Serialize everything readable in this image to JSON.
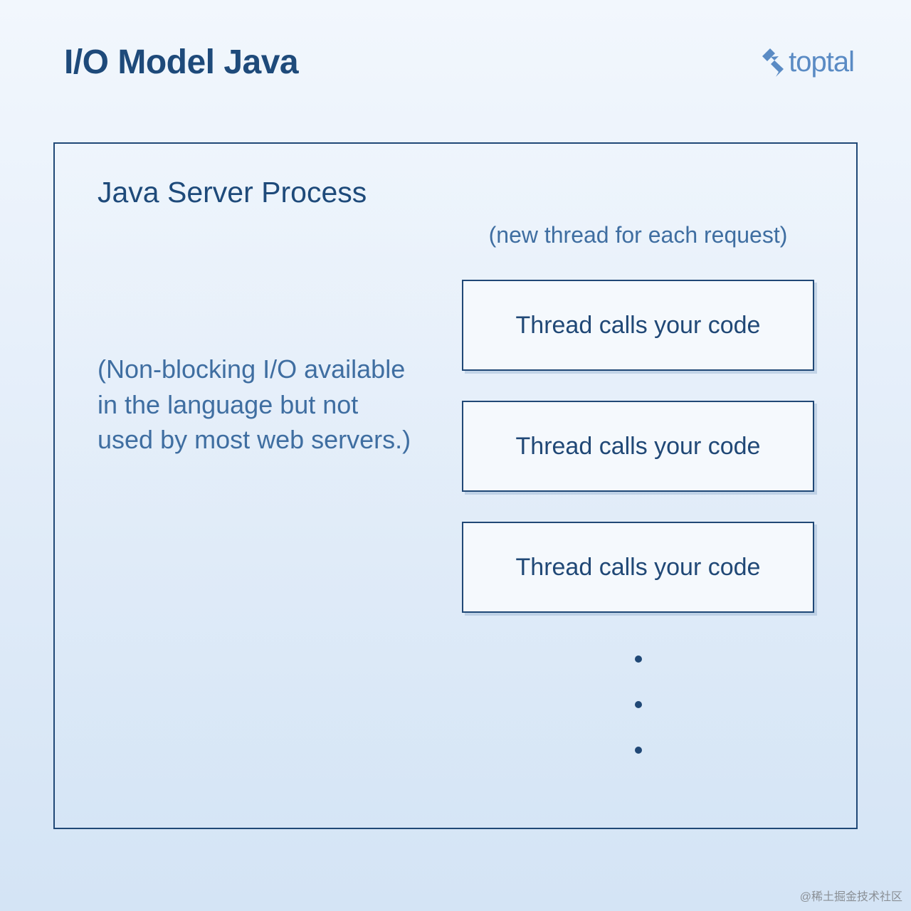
{
  "header": {
    "title": "I/O Model Java",
    "logo_text": "toptal"
  },
  "process": {
    "title": "Java Server Process",
    "note": "(Non-blocking I/O available in the language but not used by most web servers.)",
    "thread_note": "(new thread for each request)",
    "threads": [
      "Thread calls your code",
      "Thread calls your code",
      "Thread calls your code"
    ]
  },
  "watermark": "@稀土掘金技术社区"
}
